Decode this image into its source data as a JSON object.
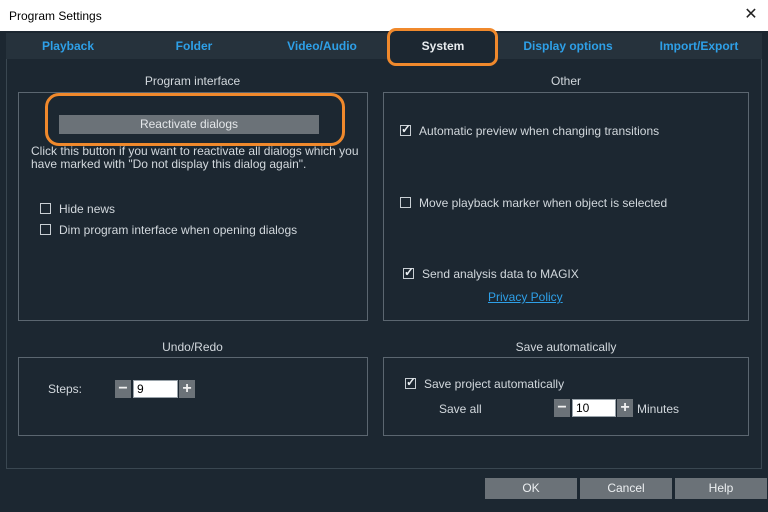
{
  "window": {
    "title": "Program Settings",
    "close_glyph": "✕"
  },
  "tabs": [
    {
      "label": "Playback"
    },
    {
      "label": "Folder"
    },
    {
      "label": "Video/Audio"
    },
    {
      "label": "System"
    },
    {
      "label": "Display options"
    },
    {
      "label": "Import/Export"
    }
  ],
  "program_interface": {
    "title": "Program interface",
    "reactivate_button": "Reactivate dialogs",
    "description_line1": "Click this button if you want to reactivate all dialogs which you",
    "description_line2": "have marked with \"Do not display this dialog again\".",
    "hide_news": {
      "label": "Hide news",
      "checked": false
    },
    "dim_interface": {
      "label": "Dim program interface when opening dialogs",
      "checked": false
    }
  },
  "other": {
    "title": "Other",
    "auto_preview": {
      "label": "Automatic preview when changing transitions",
      "checked": true
    },
    "move_marker": {
      "label": "Move playback marker when object is selected",
      "checked": false
    },
    "send_analysis": {
      "label": "Send analysis data to MAGIX",
      "checked": true
    },
    "privacy_link": "Privacy Policy"
  },
  "undo_redo": {
    "title": "Undo/Redo",
    "steps_label": "Steps:",
    "steps_value": "9"
  },
  "save_auto": {
    "title": "Save automatically",
    "save_project": {
      "label": "Save project automatically",
      "checked": true
    },
    "save_all_label": "Save all",
    "minutes_value": "10",
    "minutes_label": "Minutes"
  },
  "stepper": {
    "minus": "−",
    "plus": "+"
  },
  "footer": {
    "ok": "OK",
    "cancel": "Cancel",
    "help": "Help"
  },
  "colors": {
    "accent_link": "#2ea0e8",
    "highlight": "#f0892c",
    "background": "#1c2731"
  }
}
